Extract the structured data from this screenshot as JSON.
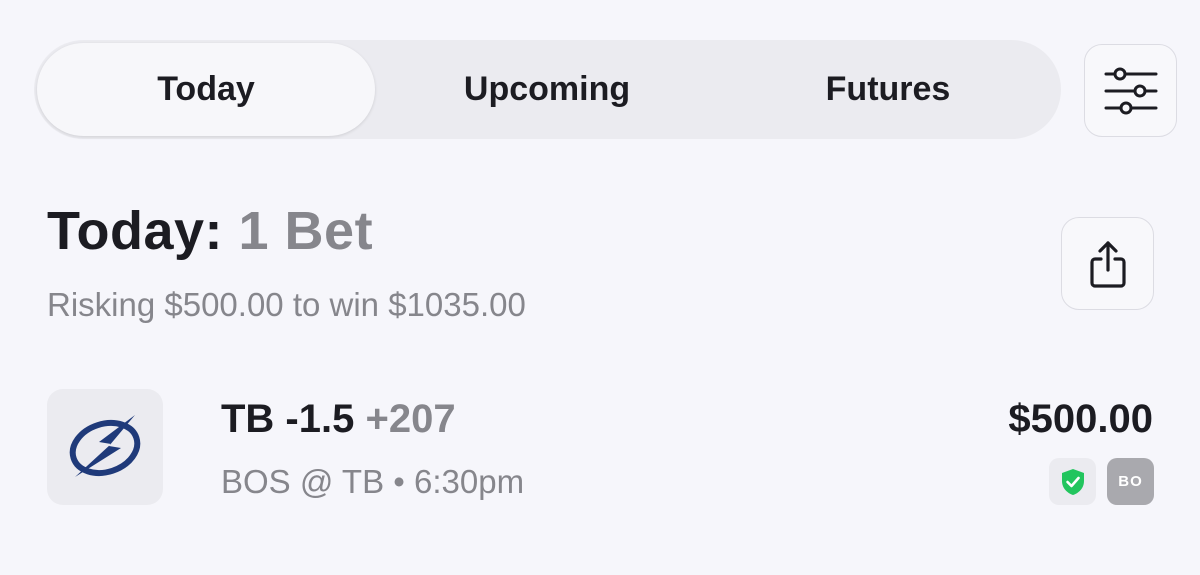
{
  "tabs": [
    {
      "label": "Today",
      "active": true
    },
    {
      "label": "Upcoming",
      "active": false
    },
    {
      "label": "Futures",
      "active": false
    }
  ],
  "filter_button": {
    "icon": "sliders-icon"
  },
  "summary": {
    "title": "Today:",
    "count": "1 Bet",
    "subtitle": "Risking $500.00 to win $1035.00"
  },
  "share_button": {
    "icon": "share-icon"
  },
  "bet": {
    "team_logo": "lightning-bolt-logo",
    "pick": "TB -1.5",
    "odds": "+207",
    "matchup": "BOS @ TB • 6:30pm",
    "amount": "$500.00",
    "badges": {
      "shield_icon": "shield-check-icon",
      "book": "BO"
    }
  },
  "colors": {
    "background": "#f6f6fb",
    "muted_text": "#86868c",
    "shield_green": "#22c55e",
    "logo_blue": "#1f3a7a"
  }
}
